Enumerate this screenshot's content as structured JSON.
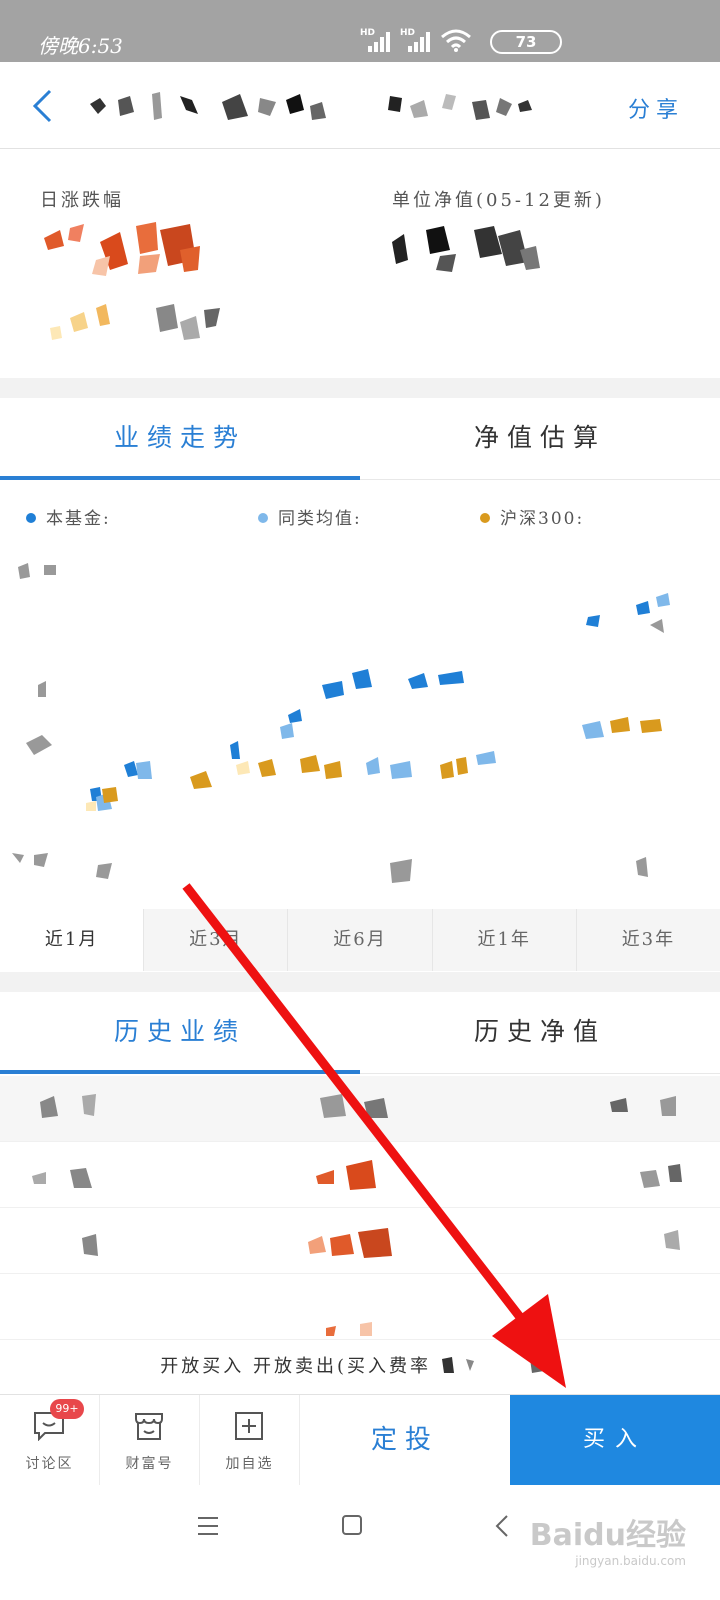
{
  "status_bar": {
    "time": "傍晚6:53",
    "signal1": "HD",
    "signal2": "HD",
    "battery": "73"
  },
  "header": {
    "share_label": "分享"
  },
  "summary": {
    "daily_change_label": "日涨跌幅",
    "nav_label": "单位净值(05-12更新)"
  },
  "performance_tabs": [
    {
      "label": "业绩走势",
      "active": true
    },
    {
      "label": "净值估算",
      "active": false
    }
  ],
  "legend": [
    {
      "label": "本基金:",
      "color": "#1f7fd6"
    },
    {
      "label": "同类均值:",
      "color": "#7fb8ea"
    },
    {
      "label": "沪深300:",
      "color": "#d99a1e"
    }
  ],
  "periods": [
    "近1月",
    "近3月",
    "近6月",
    "近1年",
    "近3年"
  ],
  "history_tabs": [
    {
      "label": "历史业绩",
      "active": true
    },
    {
      "label": "历史净值",
      "active": false
    }
  ],
  "notice": "开放买入 开放卖出(买入费率",
  "bottom_bar": {
    "discuss_label": "讨论区",
    "discuss_badge": "99+",
    "wealth_label": "财富号",
    "watchlist_label": "加自选",
    "fixed_invest_label": "定投",
    "buy_label": "买入"
  },
  "watermark": {
    "brand": "Baidu经验",
    "url": "jingyan.baidu.com"
  },
  "colors": {
    "accent": "#2a7fd4",
    "buy": "#1f88e0",
    "badge": "#e8474b",
    "arrow": "#ee1111"
  }
}
